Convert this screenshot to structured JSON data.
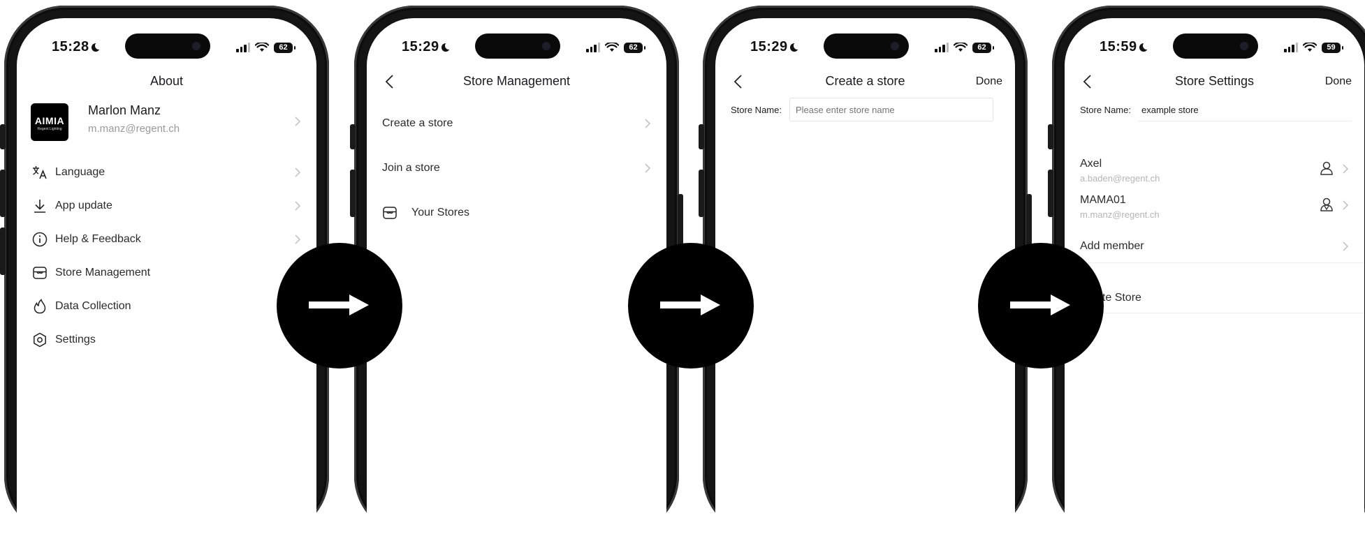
{
  "screens": [
    {
      "time": "15:28",
      "battery": "62",
      "title": "About",
      "profile": {
        "logo_text": "AIMIA",
        "logo_sub": "Regent Lighting",
        "name": "Marlon Manz",
        "email": "m.manz@regent.ch"
      },
      "menu": [
        {
          "label": "Language",
          "icon": "translate-icon"
        },
        {
          "label": "App update",
          "icon": "download-icon"
        },
        {
          "label": "Help & Feedback",
          "icon": "info-icon"
        },
        {
          "label": "Store Management",
          "icon": "store-icon"
        },
        {
          "label": "Data Collection",
          "icon": "flame-icon"
        },
        {
          "label": "Settings",
          "icon": "settings-gear-icon"
        }
      ]
    },
    {
      "time": "15:29",
      "battery": "62",
      "title": "Store Management",
      "items": [
        "Create a store",
        "Join a store"
      ],
      "stores_label": "Your Stores"
    },
    {
      "time": "15:29",
      "battery": "62",
      "title": "Create a store",
      "done": "Done",
      "field_label": "Store Name:",
      "field_placeholder": "Please enter store name"
    },
    {
      "time": "15:59",
      "battery": "59",
      "title": "Store Settings",
      "done": "Done",
      "field_label": "Store Name:",
      "field_value": "example store",
      "members": [
        {
          "name": "Axel",
          "email": "a.baden@regent.ch",
          "role_icon": "person-icon"
        },
        {
          "name": "MAMA01",
          "email": "m.manz@regent.ch",
          "role_icon": "person-admin-icon"
        }
      ],
      "add_member": "Add member",
      "delete_store": "ete Store"
    }
  ],
  "colors": {
    "text": "#1c1c1e",
    "secondary": "#9a9a9a",
    "frame": "#141414",
    "arrow_bg": "#000000"
  }
}
